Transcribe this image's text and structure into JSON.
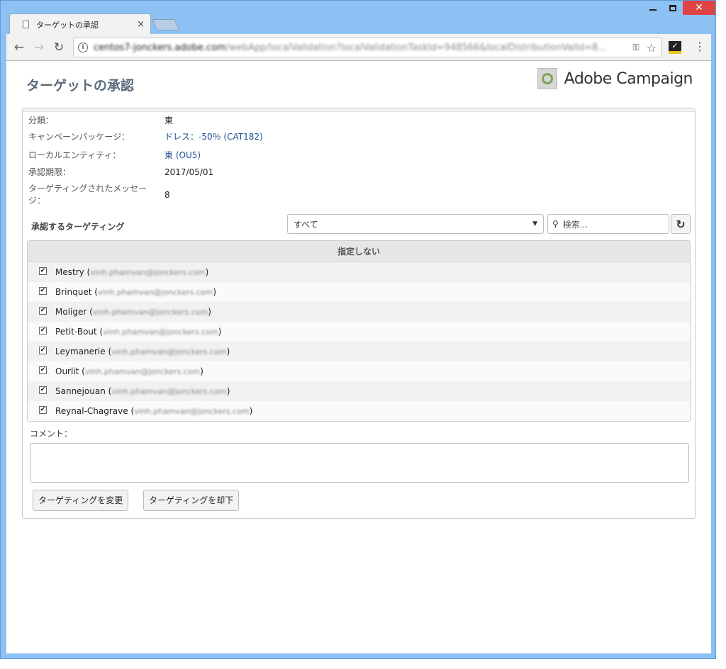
{
  "browser": {
    "tab_title": "ターゲットの承認",
    "tab_close": "×",
    "url_host": "centos7-jonckers.adobe.com",
    "url_path": "/webApp/localValidation?localValidationTaskId=948566&localDistributionValId=8..."
  },
  "header": {
    "title": "ターゲットの承認",
    "brand": "Adobe Campaign"
  },
  "fields": [
    {
      "label": "分類：",
      "value": "東",
      "link": false
    },
    {
      "label": "キャンペーンパッケージ：",
      "value": "ドレス：-50％ (CAT182)",
      "link": true
    },
    {
      "label": "ローカルエンティティ：",
      "value": "東 (OU5)",
      "link": true
    },
    {
      "label": "承認期限：",
      "value": "2017/05/01",
      "link": false
    },
    {
      "label": "ターゲティングされたメッセージ：",
      "value": "8",
      "link": false
    }
  ],
  "targeting": {
    "label": "承認するターゲティング",
    "filter_selected": "すべて",
    "search_placeholder": "検索..."
  },
  "list": {
    "header": "指定しない",
    "rows": [
      {
        "name": "Mestry",
        "email": "vinh.phamvan@jonckers.com"
      },
      {
        "name": "Brinquet",
        "email": "vinh.phamvan@jonckers.com"
      },
      {
        "name": "Moliger",
        "email": "vinh.phamvan@jonckers.com"
      },
      {
        "name": "Petit-Bout",
        "email": "vinh.phamvan@jonckers.com"
      },
      {
        "name": "Leymanerie",
        "email": "vinh.phamvan@jonckers.com"
      },
      {
        "name": "Ourlit",
        "email": "vinh.phamvan@jonckers.com"
      },
      {
        "name": "Sannejouan",
        "email": "vinh.phamvan@jonckers.com"
      },
      {
        "name": "Reynal-Chagrave",
        "email": "vinh.phamvan@jonckers.com"
      }
    ]
  },
  "comment": {
    "label": "コメント："
  },
  "buttons": {
    "change": "ターゲティングを変更",
    "reject": "ターゲティングを却下"
  }
}
